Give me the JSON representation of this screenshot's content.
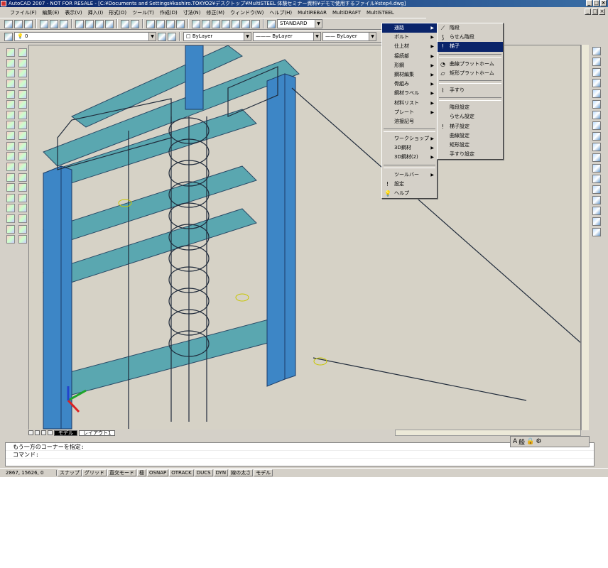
{
  "title": "AutoCAD 2007 - NOT FOR RESALE - [C:¥Documents and Settings¥kashiro.TOKYO2¥デスクトップ¥MultiSTEEL 体験セミナー資料¥デモで使用するファイル¥step4.dwg]",
  "menubar": [
    "ファイル(F)",
    "編集(E)",
    "表示(V)",
    "挿入(I)",
    "形式(O)",
    "ツール(T)",
    "作成(D)",
    "寸法(N)",
    "修正(M)",
    "ウィンドウ(W)",
    "ヘルプ(H)",
    "MultiREBAR",
    "MultiDRAFT",
    "MultiSTEEL"
  ],
  "toolbar": {
    "text_style": "STANDARD",
    "layer": "0",
    "color": "ByLayer",
    "linetype": "ByLayer",
    "lineweight": "ByLayer"
  },
  "main_menu": [
    "通路",
    "ボルト",
    "仕上材",
    "接続部",
    "形鋼",
    "鋼材編集",
    "骨組み",
    "鋼材ラベル",
    "材料リスト",
    "プレート",
    "溶接記号",
    "ワークショップ",
    "3D鋼材",
    "3D鋼材(2)",
    "ツールバー",
    "設定",
    "ヘルプ"
  ],
  "sub_menu": [
    "階段",
    "らせん階段",
    "梯子",
    "曲線プラットホーム",
    "矩形プラットホーム",
    "手すり",
    "階段設定",
    "らせん設定",
    "梯子設定",
    "曲線設定",
    "矩形設定",
    "手すり設定"
  ],
  "layout_tabs": [
    "モデル",
    "レイアウト1"
  ],
  "command_lines": [
    "もう一方のコーナーを指定:",
    "コマンド:"
  ],
  "coords": "2867, 15626, 0",
  "status_buttons": [
    "スナップ",
    "グリッド",
    "直交モード",
    "極",
    "OSNAP",
    "OTRACK",
    "DUCS",
    "DYN",
    "線の太さ",
    "モデル"
  ],
  "status_icons": [
    "A",
    "般"
  ]
}
